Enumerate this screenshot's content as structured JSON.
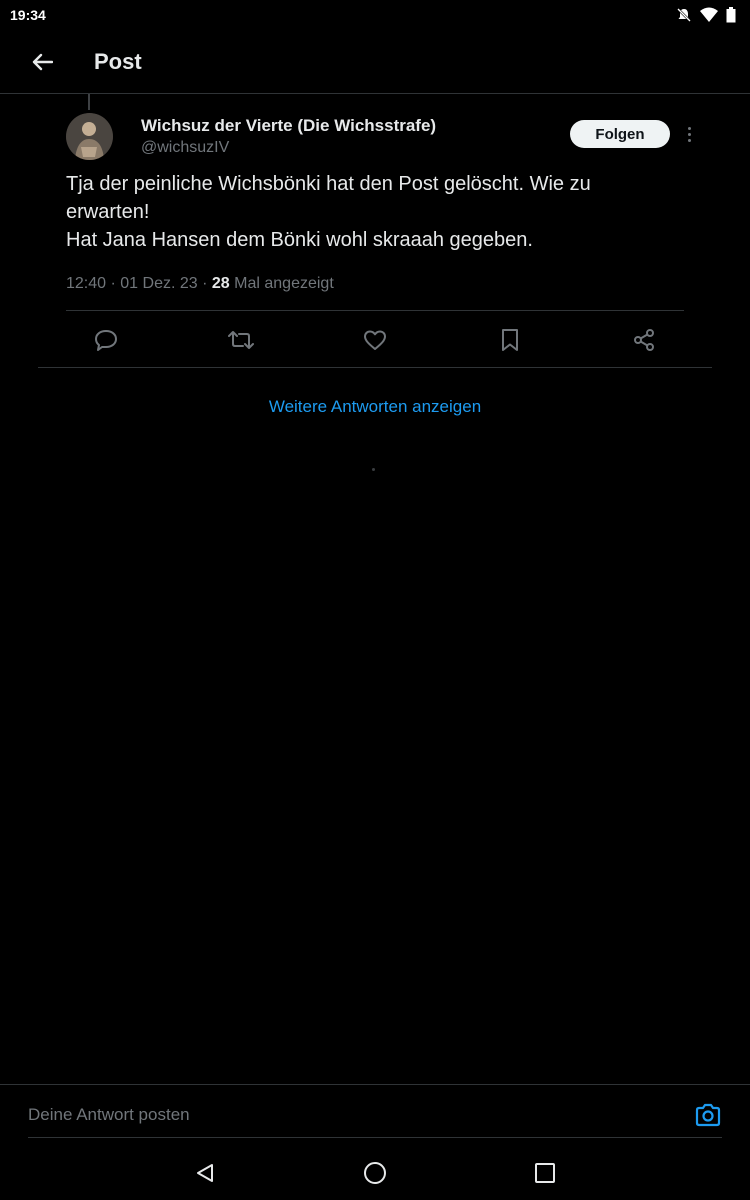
{
  "statusbar": {
    "time": "19:34"
  },
  "appbar": {
    "title": "Post"
  },
  "post": {
    "author_name": "Wichsuz der Vierte (Die Wichsstrafe)",
    "author_handle": "@wichsuzIV",
    "follow_label": "Folgen",
    "text_line1": "Tja der peinliche Wichsbönki hat den Post gelöscht. Wie zu",
    "text_line2": "erwarten!",
    "text_line3": "Hat Jana Hansen dem Bönki wohl skraaah gegeben.",
    "time": "12:40",
    "date": "01 Dez. 23",
    "views_count": "28",
    "views_label": "Mal angezeigt"
  },
  "more_replies_label": "Weitere Antworten anzeigen",
  "reply": {
    "placeholder": "Deine Antwort posten"
  },
  "colors": {
    "accent": "#1d9bf0",
    "background": "#000000",
    "secondary_text": "#71767b"
  }
}
